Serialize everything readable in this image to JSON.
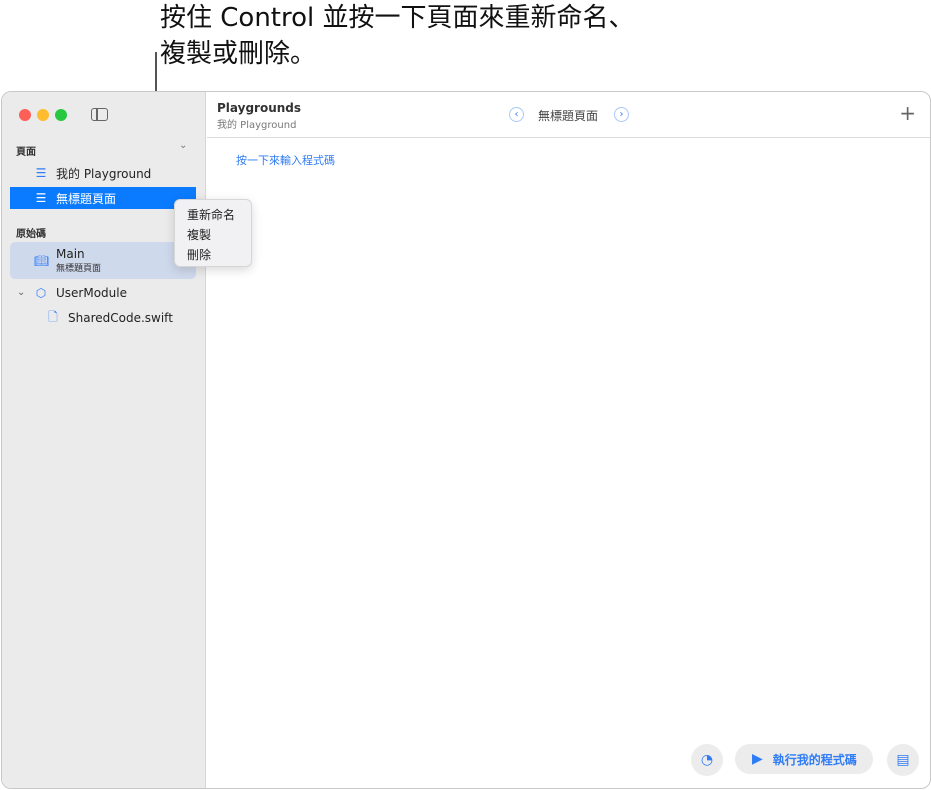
{
  "callout": {
    "line1": "按住 Control 並按一下頁面來重新命名、",
    "line2": "複製或刪除。"
  },
  "sidebar": {
    "pages_header": "頁面",
    "pages": [
      {
        "label": "我的 Playground"
      },
      {
        "label": "無標題頁面"
      }
    ],
    "source_header": "原始碼",
    "main_item": {
      "label": "Main",
      "sub": "無標題頁面"
    },
    "module": "UserModule",
    "file": "SharedCode.swift"
  },
  "context_menu": [
    "重新命名",
    "複製",
    "刪除"
  ],
  "toolbar": {
    "title": "Playgrounds",
    "subtitle": "我的 Playground",
    "page_title": "無標題頁面"
  },
  "editor": {
    "placeholder": "按一下來輸入程式碼"
  },
  "bottom": {
    "run_label": "執行我的程式碼"
  }
}
